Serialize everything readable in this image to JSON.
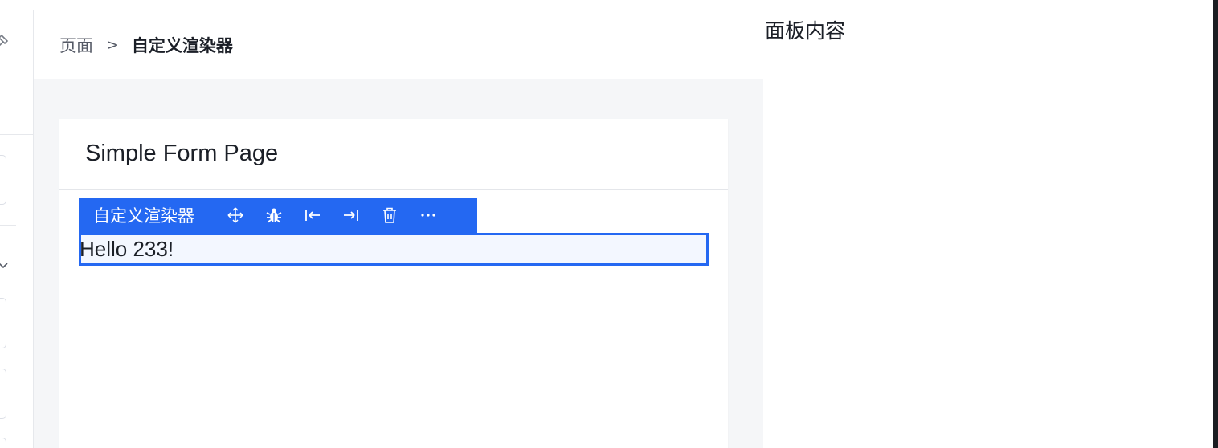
{
  "breadcrumb": {
    "parent": "页面",
    "separator": ">",
    "current": "自定义渲染器"
  },
  "card": {
    "title": "Simple Form Page"
  },
  "toolbar": {
    "label": "自定义渲染器",
    "icons": [
      "move-icon",
      "debug-icon",
      "insert-before-icon",
      "insert-after-icon",
      "delete-icon",
      "more-icon"
    ],
    "color": "#2468f2"
  },
  "component": {
    "text": "Hello 233!"
  },
  "panel": {
    "content": "面板内容"
  }
}
